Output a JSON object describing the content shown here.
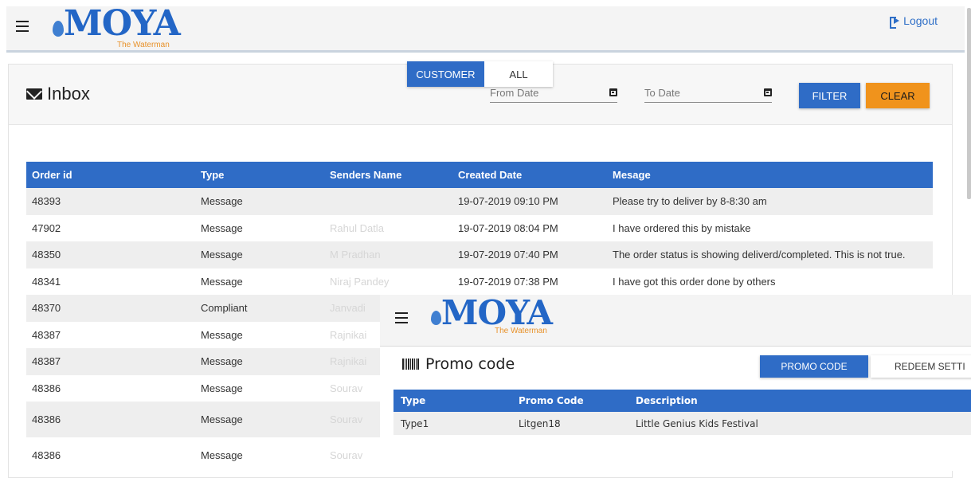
{
  "header": {
    "logo_text": "MOYA",
    "logo_tagline": "The Waterman",
    "logout_label": "Logout"
  },
  "inbox": {
    "title": "Inbox",
    "from_date_placeholder": "From Date",
    "to_date_placeholder": "To Date",
    "filter_label": "FILTER",
    "clear_label": "CLEAR",
    "tabs": [
      "CUSTOMER",
      "ALL"
    ],
    "columns": [
      "Order id",
      "Type",
      "Senders Name",
      "Created Date",
      "Mesage"
    ],
    "rows": [
      {
        "id": "48393",
        "type": "Message",
        "sender": "",
        "date": "19-07-2019 09:10 PM",
        "message": "Please try to deliver by 8-8:30 am"
      },
      {
        "id": "47902",
        "type": "Message",
        "sender": "Rahul Datla",
        "date": "19-07-2019 08:04 PM",
        "message": "I have ordered this by mistake"
      },
      {
        "id": "48350",
        "type": "Message",
        "sender": "M Pradhan",
        "date": "19-07-2019 07:40 PM",
        "message": "The order status is showing deliverd/completed. This is not true."
      },
      {
        "id": "48341",
        "type": "Message",
        "sender": "Niraj Pandey",
        "date": "19-07-2019 07:38 PM",
        "message": "I have got this order done by others"
      },
      {
        "id": "48370",
        "type": "Compliant",
        "sender": "Janvadi",
        "date": "",
        "message": ""
      },
      {
        "id": "48387",
        "type": "Message",
        "sender": "Rajnikai",
        "date": "",
        "message": ""
      },
      {
        "id": "48387",
        "type": "Message",
        "sender": "Rajnikai",
        "date": "",
        "message": ""
      },
      {
        "id": "48386",
        "type": "Message",
        "sender": "Sourav",
        "date": "",
        "message": ""
      },
      {
        "id": "48386",
        "type": "Message",
        "sender": "Sourav",
        "date": "",
        "message": ""
      },
      {
        "id": "48386",
        "type": "Message",
        "sender": "Sourav",
        "date": "",
        "message": ""
      }
    ]
  },
  "promo": {
    "logo_text": "MOYA",
    "logo_tagline": "The Waterman",
    "title": "Promo code",
    "promo_code_button": "PROMO CODE",
    "redeem_settings_button": "REDEEM SETTI",
    "columns": [
      "Type",
      "Promo Code",
      "Description"
    ],
    "rows": [
      {
        "type": "Type1",
        "code": "Litgen18",
        "description": "Little Genius Kids Festival"
      }
    ]
  },
  "colors": {
    "primary": "#2f6cc6",
    "accent": "#f0931c",
    "logo_blue": "#2366c6",
    "logo_orange": "#e8922b"
  },
  "icons": [
    "hamburger-icon",
    "envelope-icon",
    "calendar-icon",
    "logout-icon",
    "barcode-icon"
  ]
}
